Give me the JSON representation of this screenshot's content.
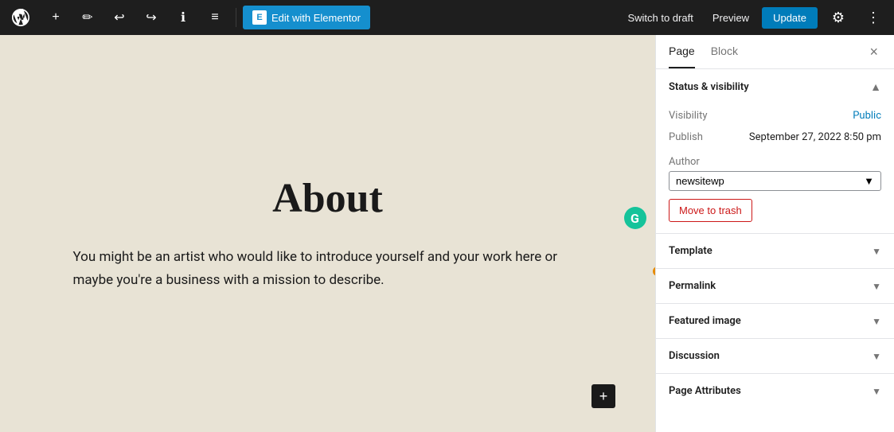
{
  "toolbar": {
    "logo_label": "WordPress",
    "add_label": "+",
    "pen_label": "✏",
    "undo_label": "↩",
    "redo_label": "↪",
    "info_label": "ℹ",
    "list_label": "≡",
    "elementor_label": "Edit with Elementor",
    "elementor_icon": "E",
    "switch_draft_label": "Switch to draft",
    "preview_label": "Preview",
    "update_label": "Update",
    "settings_label": "⚙",
    "more_label": "⋮"
  },
  "canvas": {
    "page_title": "About",
    "page_body": "You might be an artist who would like to introduce yourself and your work here or maybe you're a business with a mission to describe.",
    "add_block_label": "+"
  },
  "sidebar": {
    "tab_page": "Page",
    "tab_block": "Block",
    "close_label": "×",
    "status_visibility": {
      "section_title": "Status & visibility",
      "visibility_label": "Visibility",
      "visibility_value": "Public",
      "publish_label": "Publish",
      "publish_value": "September 27, 2022 8:50 pm",
      "author_label": "Author",
      "author_value": "newsitewp",
      "move_trash_label": "Move to trash"
    },
    "template": {
      "section_title": "Template"
    },
    "permalink": {
      "section_title": "Permalink"
    },
    "featured_image": {
      "section_title": "Featured image"
    },
    "discussion": {
      "section_title": "Discussion"
    },
    "page_attributes": {
      "section_title": "Page Attributes"
    }
  }
}
